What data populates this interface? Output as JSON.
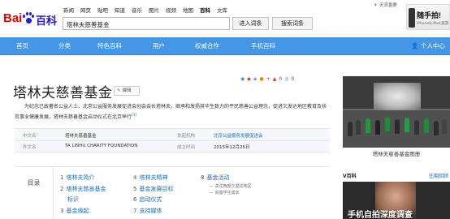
{
  "logo": {
    "brand": "Bai",
    "name": "百科"
  },
  "nav_links": [
    "新闻",
    "网页",
    "贴吧",
    "知道",
    "音乐",
    "图片",
    "视频",
    "地图",
    "百科",
    "文库"
  ],
  "nav_active_index": 8,
  "search": {
    "value": "塔林夫慈善基金"
  },
  "buttons": {
    "enter": "进入词条",
    "search": "搜索词条"
  },
  "weather": "天流香赛",
  "ad": {
    "title": "随手拍!",
    "sub": "iPhone8,iPad,旅游"
  },
  "main_nav": {
    "items": [
      "首页",
      "分类",
      "特色百科",
      "用户",
      "权威合作",
      "手机百科"
    ],
    "user": "个人中心"
  },
  "article": {
    "title": "塔林夫慈善基金",
    "edit_label": "编辑",
    "share": [
      "◉",
      "◆",
      "◈",
      "●",
      "+",
      "▲",
      "◎",
      "0",
      "▪",
      "0"
    ],
    "summary": "为纪念已故著名公益人士、北京公益服务发展促进会创会会长塔林夫，继承和发扬其毕生致力的平民慈善公益理念，促进欠发达地区教育及扶贫事业健康发展，塔林夫慈善基金启动仪式在北京举行",
    "ref": "[1]"
  },
  "infobox": {
    "rows": [
      {
        "label_left": "中文名",
        "value_left": "塔林夫慈善基金",
        "label_right": "发起机构",
        "value_right": "北京公益服务发展促进会"
      },
      {
        "label_left": "外文名",
        "value_left": "TA LINHU CHARITY FOUNDATION",
        "label_right": "成立时间",
        "value_right": "2015年12月26日"
      }
    ]
  },
  "toc": {
    "label": "目录",
    "entries": [
      {
        "num": "1",
        "text": "塔林夫简介"
      },
      {
        "num": "2",
        "text": "塔林夫慈善基金"
      },
      {
        "num": "",
        "text": "标识"
      },
      {
        "num": "3",
        "text": "基金缘起"
      },
      {
        "num": "4",
        "text": "塔林夫精神"
      },
      {
        "num": "5",
        "text": "基金发展目标"
      },
      {
        "num": "6",
        "text": "启动仪式"
      },
      {
        "num": "7",
        "text": "支持媒体"
      },
      {
        "num": "8",
        "text": "基金活动"
      }
    ],
    "sub_items": [
      "关注西部欠发达地区",
      "贫富学生成长"
    ]
  },
  "media": {
    "caption": "塔林夫慈善基金图册",
    "v_label": "V百科",
    "v_more": "往期回顾",
    "video_text": "手机自拍深度调查"
  }
}
